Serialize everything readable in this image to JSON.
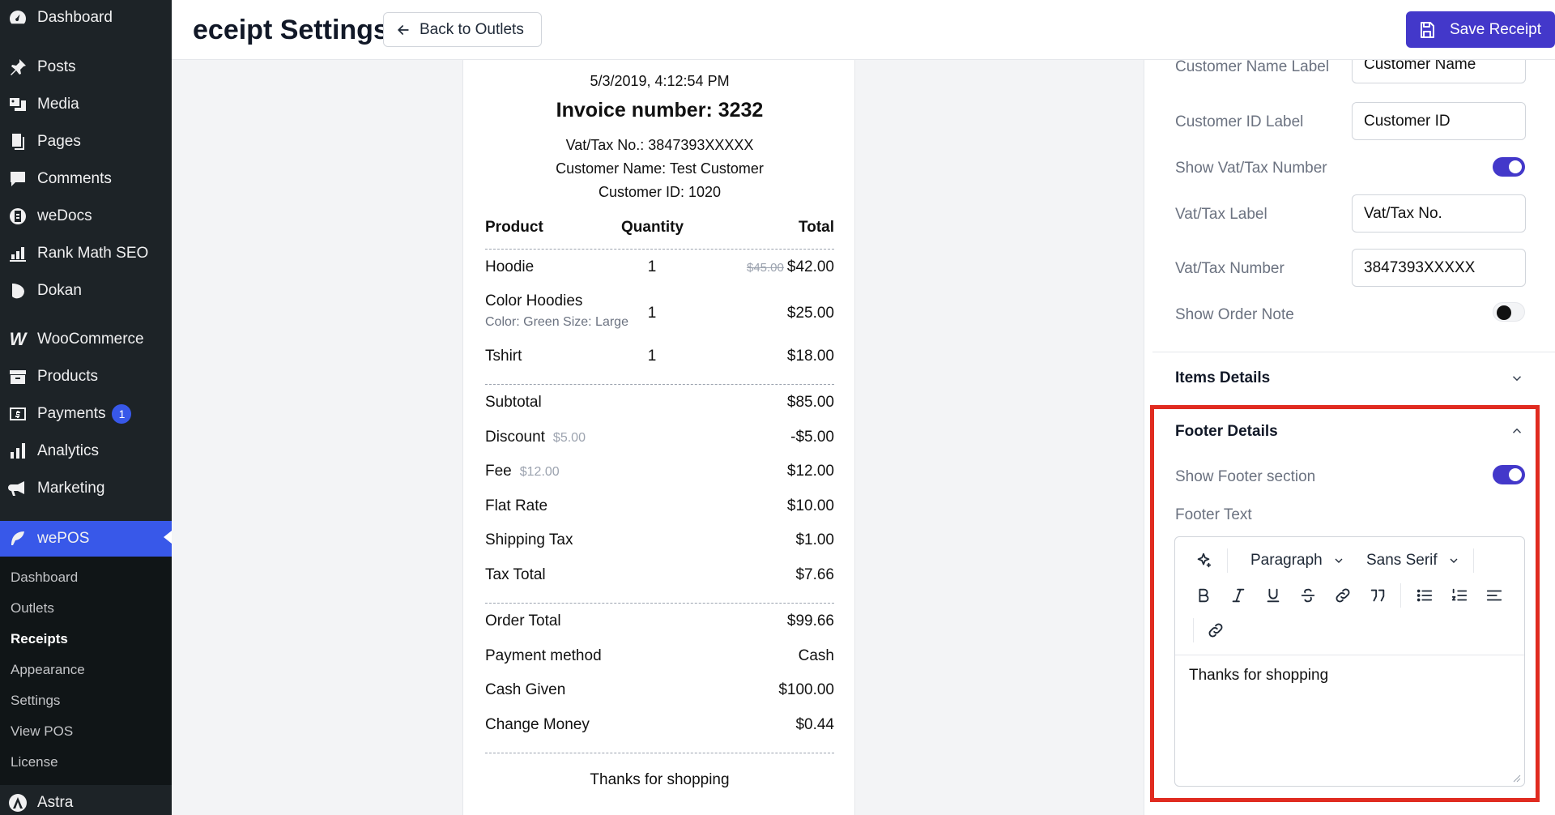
{
  "sidebar": {
    "items": [
      {
        "label": "Dashboard",
        "icon": "dashboard-icon"
      },
      {
        "label": "Posts",
        "icon": "pin-icon"
      },
      {
        "label": "Media",
        "icon": "media-icon"
      },
      {
        "label": "Pages",
        "icon": "pages-icon"
      },
      {
        "label": "Comments",
        "icon": "comment-icon"
      },
      {
        "label": "weDocs",
        "icon": "docs-icon"
      },
      {
        "label": "Rank Math SEO",
        "icon": "chart-icon"
      },
      {
        "label": "Dokan",
        "icon": "dokan-icon"
      },
      {
        "label": "WooCommerce",
        "icon": "woo-icon"
      },
      {
        "label": "Products",
        "icon": "archive-icon"
      },
      {
        "label": "Payments",
        "icon": "dollar-icon",
        "badge": "1"
      },
      {
        "label": "Analytics",
        "icon": "bar-chart-icon"
      },
      {
        "label": "Marketing",
        "icon": "megaphone-icon"
      },
      {
        "label": "wePOS",
        "icon": "wepos-icon"
      },
      {
        "label": "Astra",
        "icon": "astra-icon"
      }
    ],
    "submenu": [
      "Dashboard",
      "Outlets",
      "Receipts",
      "Appearance",
      "Settings",
      "View POS",
      "License"
    ]
  },
  "header": {
    "title": "eceipt Settings",
    "back_label": "Back to Outlets",
    "save_label": "Save Receipt"
  },
  "receipt": {
    "datetime": "5/3/2019, 4:12:54 PM",
    "invoice": "Invoice number: 3232",
    "vat": "Vat/Tax No.: 3847393XXXXX",
    "customer_name": "Customer Name: Test Customer",
    "customer_id": "Customer ID: 1020",
    "columns": {
      "product": "Product",
      "quantity": "Quantity",
      "total": "Total"
    },
    "items": [
      {
        "name": "Hoodie",
        "qty": "1",
        "old_price": "$45.00",
        "total": "$42.00"
      },
      {
        "name": "Color Hoodies",
        "variant": "Color: Green  Size: Large",
        "qty": "1",
        "total": "$25.00"
      },
      {
        "name": "Tshirt",
        "qty": "1",
        "total": "$18.00"
      }
    ],
    "summary": [
      {
        "label": "Subtotal",
        "value": "$85.00"
      },
      {
        "label": "Discount",
        "note": "$5.00",
        "value": "-$5.00"
      },
      {
        "label": "Fee",
        "note": "$12.00",
        "value": "$12.00"
      },
      {
        "label": "Flat Rate",
        "value": "$10.00"
      },
      {
        "label": "Shipping Tax",
        "value": "$1.00"
      },
      {
        "label": "Tax Total",
        "value": "$7.66"
      }
    ],
    "totals": [
      {
        "label": "Order Total",
        "value": "$99.66"
      },
      {
        "label": "Payment method",
        "value": "Cash"
      },
      {
        "label": "Cash Given",
        "value": "$100.00"
      },
      {
        "label": "Change Money",
        "value": "$0.44"
      }
    ],
    "footer": "Thanks for shopping"
  },
  "panel": {
    "customer_name_label": "Customer Name Label",
    "customer_name_value": "Customer Name",
    "customer_id_label": "Customer ID Label",
    "customer_id_value": "Customer ID",
    "show_vat_label": "Show Vat/Tax Number",
    "show_vat_on": true,
    "vat_label_label": "Vat/Tax Label",
    "vat_label_value": "Vat/Tax No.",
    "vat_number_label": "Vat/Tax Number",
    "vat_number_value": "3847393XXXXX",
    "show_order_note_label": "Show Order Note",
    "show_order_note_on": false,
    "items_details_title": "Items Details",
    "footer_details_title": "Footer Details",
    "show_footer_label": "Show Footer section",
    "show_footer_on": true,
    "footer_text_label": "Footer Text",
    "editor": {
      "paragraph": "Paragraph",
      "font": "Sans Serif",
      "content": "Thanks for shopping"
    }
  },
  "colors": {
    "accent": "#4338ca",
    "highlight": "#e02b20",
    "sidebar": "#1d2327"
  }
}
